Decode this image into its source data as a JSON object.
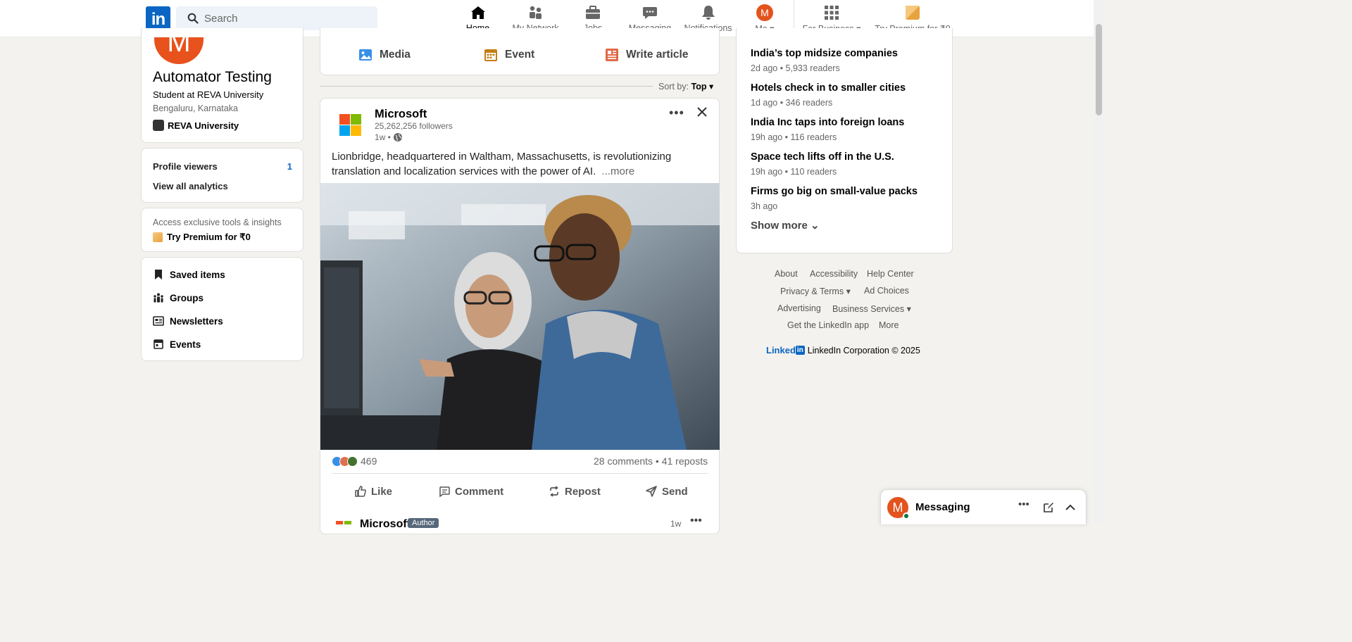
{
  "nav": {
    "search_placeholder": "Search",
    "items": [
      {
        "label": "Home",
        "icon": "home-icon",
        "active": true
      },
      {
        "label": "My Network",
        "icon": "network-icon"
      },
      {
        "label": "Jobs",
        "icon": "briefcase-icon"
      },
      {
        "label": "Messaging",
        "icon": "messaging-icon"
      },
      {
        "label": "Notifications",
        "icon": "bell-icon"
      },
      {
        "label": "Me",
        "avatar_letter": "M"
      },
      {
        "label": "For Business",
        "icon": "grid-icon"
      },
      {
        "label": "Try Premium for ₹0",
        "icon": "premium-icon"
      }
    ]
  },
  "profile": {
    "avatar_letter": "M",
    "name": "Automator Testing",
    "headline": "Student at REVA University",
    "location": "Bengaluru, Karnataka",
    "school": "REVA University"
  },
  "analytics": {
    "profile_viewers_label": "Profile viewers",
    "profile_viewers_value": "1",
    "view_all": "View all analytics"
  },
  "premium_card": {
    "hint": "Access exclusive tools & insights",
    "link": "Try Premium for ₹0"
  },
  "side_links": [
    "Saved items",
    "Groups",
    "Newsletters",
    "Events"
  ],
  "share": {
    "media": "Media",
    "event": "Event",
    "article": "Write article"
  },
  "sort": {
    "label": "Sort by:",
    "value": "Top"
  },
  "post": {
    "author": "Microsoft",
    "followers": "25,262,256 followers",
    "time": "1w •",
    "text": "Lionbridge, headquartered in Waltham, Massachusetts, is revolutionizing translation and localization services with the power of AI.",
    "more": "...more",
    "reactions_count": "469",
    "comments_reposts": "28 comments • 41 reposts",
    "actions": [
      "Like",
      "Comment",
      "Repost",
      "Send"
    ]
  },
  "next_post": {
    "author": "Microsoft",
    "badge": "Author",
    "time": "1w"
  },
  "news": [
    {
      "title": "India’s top midsize companies",
      "meta": "2d ago • 5,933 readers"
    },
    {
      "title": "Hotels check in to smaller cities",
      "meta": "1d ago • 346 readers"
    },
    {
      "title": "India Inc taps into foreign loans",
      "meta": "19h ago • 116 readers"
    },
    {
      "title": "Space tech lifts off in the U.S.",
      "meta": "19h ago • 110 readers"
    },
    {
      "title": "Firms go big on small-value packs",
      "meta": "3h ago"
    }
  ],
  "show_more": "Show more",
  "footer": {
    "about": "About",
    "accessibility": "Accessibility",
    "help": "Help Center",
    "privacy": "Privacy & Terms",
    "ad_choices": "Ad Choices",
    "advertising": "Advertising",
    "business_services": "Business Services",
    "get_app": "Get the LinkedIn app",
    "more": "More",
    "brand_word": "Linked",
    "brand_box": "in",
    "copyright": "LinkedIn Corporation © 2025"
  },
  "messaging": {
    "label": "Messaging",
    "avatar_letter": "M"
  },
  "colors": {
    "brand": "#0a66c2",
    "avatar": "#e3531d",
    "background": "#f4f2ee"
  }
}
